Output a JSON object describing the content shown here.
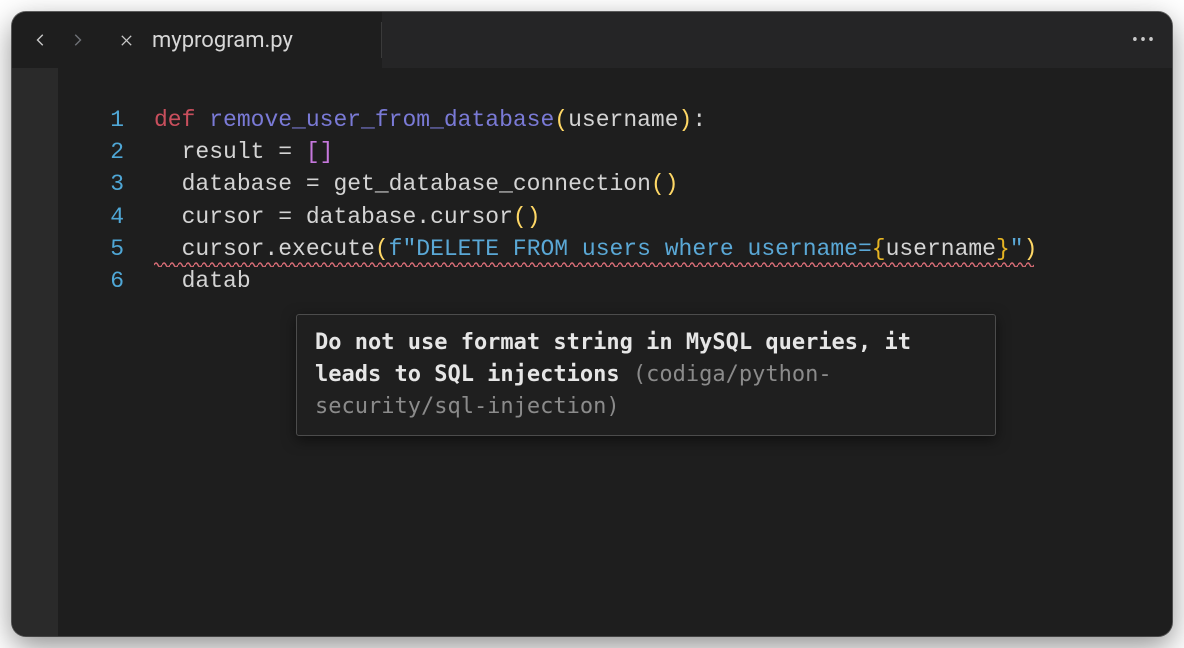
{
  "tab": {
    "filename": "myprogram.py"
  },
  "code": {
    "lines": [
      {
        "n": "1"
      },
      {
        "n": "2",
        "text": "  result = []"
      },
      {
        "n": "3",
        "text": "  database = get_database_connection()"
      },
      {
        "n": "4",
        "text": "  cursor = database.cursor()"
      },
      {
        "n": "5"
      },
      {
        "n": "6",
        "text": "  datab"
      }
    ],
    "line1": {
      "kw": "def",
      "fn": "remove_user_from_database",
      "param": "username"
    },
    "line5": {
      "prefix_indent": "  ",
      "call": "cursor.execute",
      "fprefix": "f",
      "str_open": "\"DELETE FROM users where username=",
      "brace_open": "{",
      "expr": "username",
      "brace_close": "}",
      "str_close": "\""
    }
  },
  "tooltip": {
    "bold": "Do not use format string in MySQL queries, it leads to SQL injections",
    "rule": "(codiga/python-security/sql-injection)"
  }
}
